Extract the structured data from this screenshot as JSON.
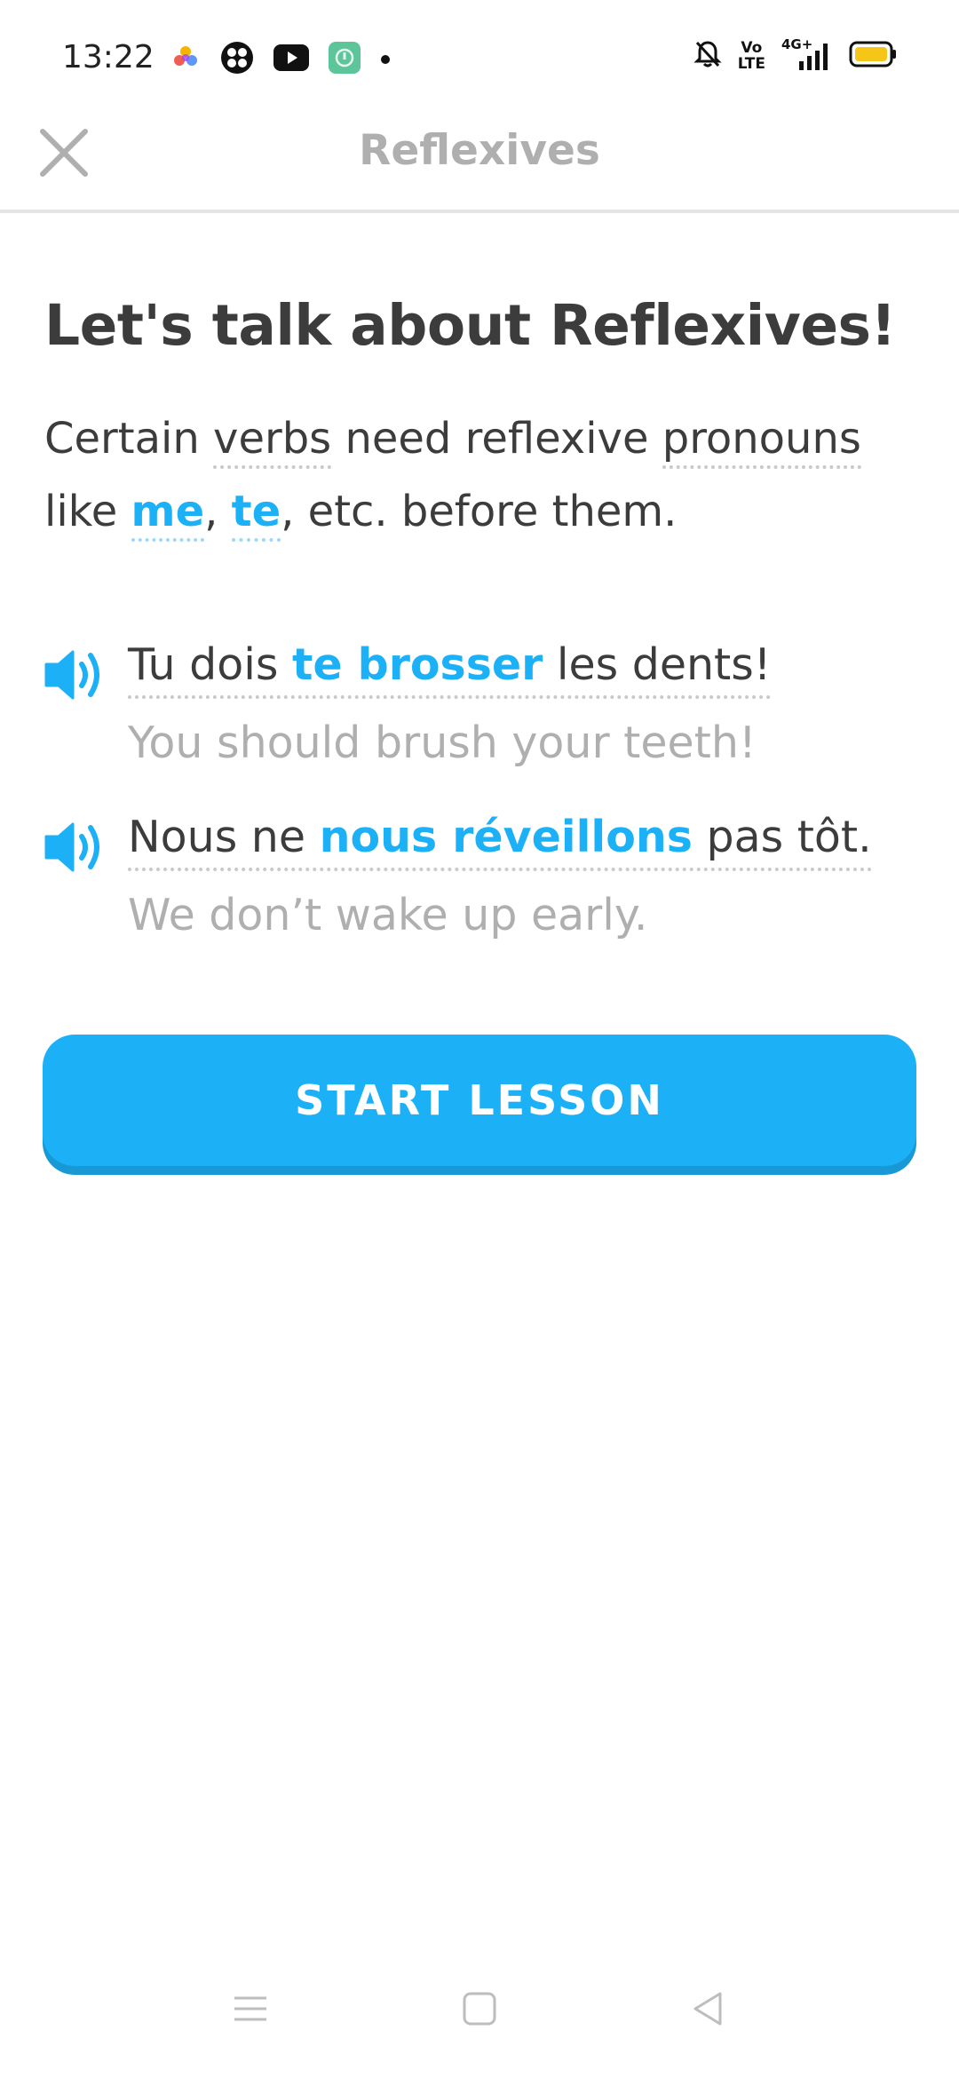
{
  "status_bar": {
    "time": "13:22",
    "left_icons": [
      "photos-icon",
      "app-icon",
      "youtube-icon",
      "tracker-icon",
      "dot-icon"
    ],
    "right_icons": [
      "mute-bell-icon",
      "volte-icon",
      "signal-4g-icon",
      "battery-icon"
    ],
    "volte_label_top": "Vo",
    "volte_label_bottom": "LTE",
    "network_label": "4G+",
    "battery_color": "#f5c518"
  },
  "header": {
    "title": "Reflexives",
    "close_icon": "close-icon"
  },
  "lesson": {
    "heading": "Let's talk about Reflexives!",
    "intro": {
      "part1": "Certain ",
      "word_verbs": "verbs",
      "part2": " need reflexive ",
      "word_pronouns": "pronouns",
      "part3": " like ",
      "word_me": "me",
      "sep": ", ",
      "word_te": "te",
      "part4": ", etc. before them."
    },
    "examples": [
      {
        "fr_before": "Tu dois ",
        "fr_highlight": "te brosser",
        "fr_after": " les dents!",
        "en": "You should brush your teeth!"
      },
      {
        "fr_before": "Nous ne ",
        "fr_highlight": "nous réveillons",
        "fr_after": " pas tôt.",
        "en": "We don’t wake up early."
      }
    ]
  },
  "start_button": {
    "label": "START LESSON"
  },
  "colors": {
    "accent": "#1cb0f6",
    "accent_shadow": "#1899d6",
    "text": "#3c3c3c",
    "muted": "#afafaf"
  },
  "nav_bar": {
    "items": [
      "menu-icon",
      "home-icon",
      "back-icon"
    ]
  }
}
